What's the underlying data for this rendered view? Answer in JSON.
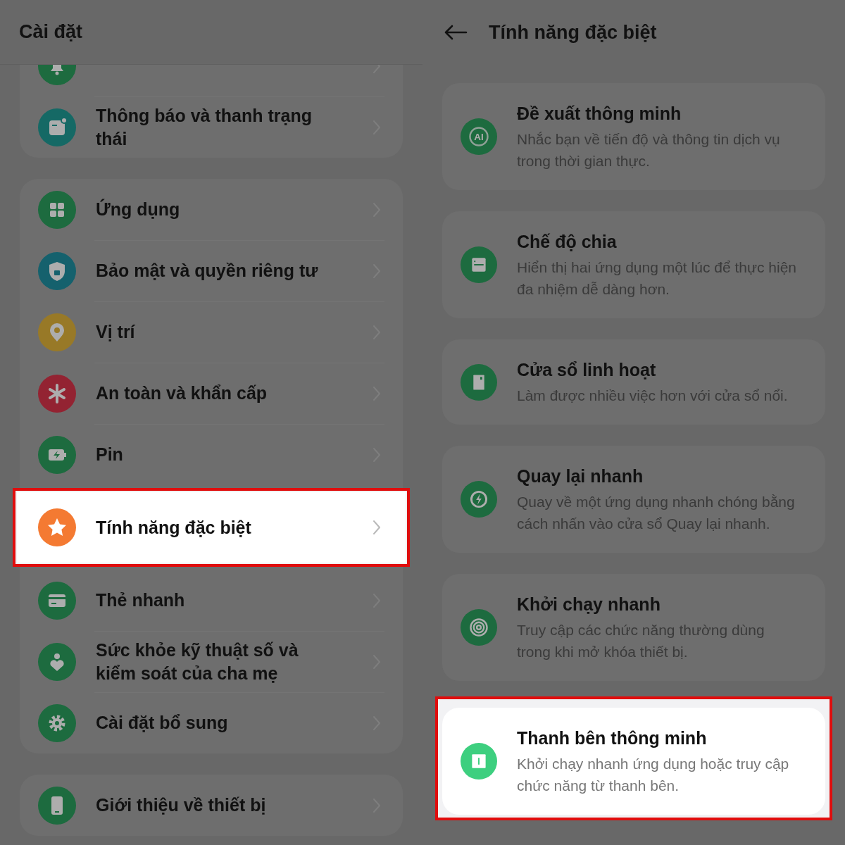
{
  "left_screen": {
    "title": "Cài đặt",
    "groups": [
      {
        "items": [
          {
            "selected": false
          },
          {
            "label": "Thông báo và thanh trạng thái",
            "selected": false
          }
        ]
      },
      {
        "items": [
          {
            "label": "Ứng dụng",
            "selected": false
          },
          {
            "label": "Bảo mật và quyền riêng tư",
            "selected": false
          },
          {
            "label": "Vị trí",
            "selected": false
          },
          {
            "label": "An toàn và khẩn cấp",
            "selected": false
          },
          {
            "label": "Pin",
            "selected": false
          },
          {
            "label": "Tính năng đặc biệt",
            "selected": true
          },
          {
            "label": "Thẻ nhanh",
            "selected": false
          },
          {
            "label": "Sức khỏe kỹ thuật số và kiểm soát của cha mẹ",
            "selected": false
          },
          {
            "label": "Cài đặt bổ sung",
            "selected": false
          }
        ]
      },
      {
        "items": [
          {
            "label": "Giới thiệu về thiết bị",
            "selected": false
          }
        ]
      }
    ]
  },
  "right_screen": {
    "title": "Tính năng đặc biệt",
    "features": [
      {
        "title": "Đề xuất thông minh",
        "description": "Nhắc bạn về tiến độ và thông tin dịch vụ trong thời gian thực.",
        "icon_text": "AI",
        "selected": false
      },
      {
        "title": "Chế độ chia",
        "description": "Hiển thị hai ứng dụng một lúc để thực hiện đa nhiệm dễ dàng hơn.",
        "selected": false
      },
      {
        "title": "Cửa sổ linh hoạt",
        "description": "Làm được nhiều việc hơn với cửa sổ nổi.",
        "selected": false
      },
      {
        "title": "Quay lại nhanh",
        "description": "Quay về một ứng dụng nhanh chóng bằng cách nhấn vào cửa sổ Quay lại nhanh.",
        "selected": false
      },
      {
        "title": "Khởi chạy nhanh",
        "description": "Truy cập các chức năng thường dùng trong khi mở khóa thiết bị.",
        "selected": false
      },
      {
        "title": "Thanh bên thông minh",
        "description": "Khởi chạy nhanh ứng dụng hoặc truy cập chức năng từ thanh bên.",
        "selected": true
      }
    ]
  }
}
